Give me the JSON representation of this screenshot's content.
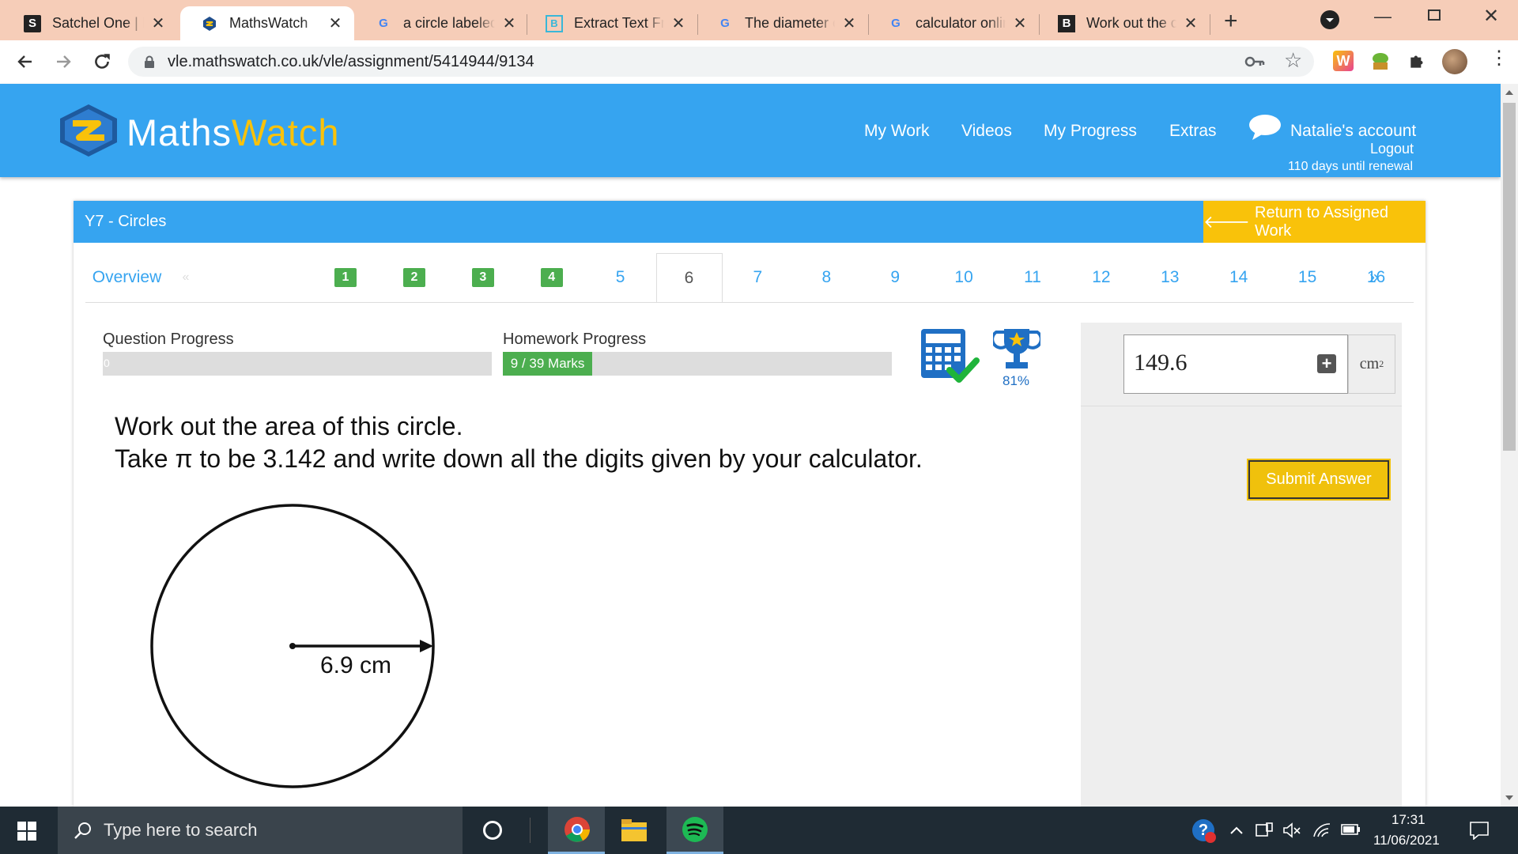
{
  "browser": {
    "tabs": [
      {
        "title": "Satchel One | L",
        "icon": "satchel-favicon",
        "active": false
      },
      {
        "title": "MathsWatch",
        "icon": "mathswatch-favicon",
        "active": true
      },
      {
        "title": "a circle labeled",
        "icon": "google-favicon",
        "active": false
      },
      {
        "title": "Extract Text Fro",
        "icon": "extract-favicon",
        "active": false
      },
      {
        "title": "The diameter o",
        "icon": "google-favicon",
        "active": false
      },
      {
        "title": "calculator onlin",
        "icon": "google-favicon",
        "active": false
      },
      {
        "title": "Work out the c",
        "icon": "brainly-favicon",
        "active": false
      }
    ],
    "url": "vle.mathswatch.co.uk/vle/assignment/5414944/9134",
    "tab_bg_color": "#f6cdb8"
  },
  "site": {
    "logo_maths": "Maths",
    "logo_watch": "Watch",
    "nav": [
      "My Work",
      "Videos",
      "My Progress",
      "Extras"
    ],
    "account": "Natalie's account",
    "logout": "Logout",
    "renewal": "110 days until renewal",
    "brand_color": "#36a4f0",
    "accent_color": "#f9c20a"
  },
  "assignment": {
    "title": "Y7 - Circles",
    "return_label": "Return to Assigned Work",
    "overview": "Overview",
    "prev": "«",
    "next": "»",
    "questions": [
      {
        "label": "1",
        "done": true
      },
      {
        "label": "2",
        "done": true
      },
      {
        "label": "3",
        "done": true
      },
      {
        "label": "4",
        "done": true
      },
      {
        "label": "5",
        "done": false
      },
      {
        "label": "6",
        "done": false,
        "current": true
      },
      {
        "label": "7",
        "done": false
      },
      {
        "label": "8",
        "done": false
      },
      {
        "label": "9",
        "done": false
      },
      {
        "label": "10",
        "done": false
      },
      {
        "label": "11",
        "done": false
      },
      {
        "label": "12",
        "done": false
      },
      {
        "label": "13",
        "done": false
      },
      {
        "label": "14",
        "done": false
      },
      {
        "label": "15",
        "done": false
      },
      {
        "label": "16",
        "done": false
      }
    ]
  },
  "progress": {
    "question_label": "Question Progress",
    "question_value": "0",
    "question_fraction": 0,
    "homework_label": "Homework Progress",
    "homework_value": "9 / 39 Marks",
    "homework_fraction": 0.23,
    "trophy_percent": "81%"
  },
  "question": {
    "line1": "Work out the area of this circle.",
    "line2": "Take π to be 3.142 and write down all the digits given by your calculator.",
    "radius_label": "6.9 cm"
  },
  "answer": {
    "value": "149.6",
    "unit": "cm",
    "unit_exp": "2",
    "submit": "Submit Answer"
  },
  "taskbar": {
    "search_placeholder": "Type here to search",
    "time": "17:31",
    "date": "11/06/2021"
  }
}
